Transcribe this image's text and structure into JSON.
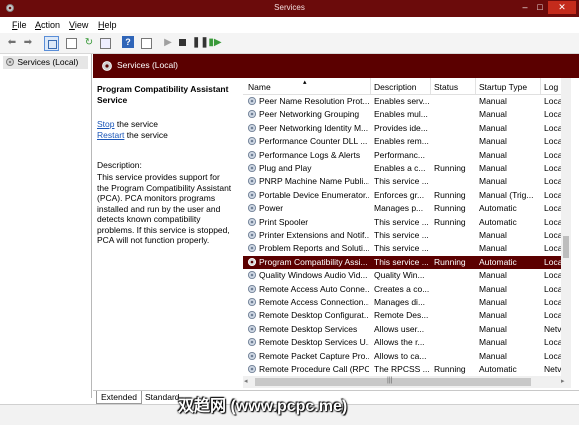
{
  "window": {
    "title": "Services"
  },
  "menus": [
    {
      "key": "F",
      "rest": "ile"
    },
    {
      "key": "A",
      "rest": "ction"
    },
    {
      "key": "V",
      "rest": "iew"
    },
    {
      "key": "H",
      "rest": "elp"
    }
  ],
  "tree": {
    "root_label": "Services (Local)"
  },
  "panel": {
    "header": "Services (Local)"
  },
  "details": {
    "service_name": "Program Compatibility Assistant Service",
    "stop_link": "Stop",
    "stop_suffix": " the service",
    "restart_link": "Restart",
    "restart_suffix": " the service",
    "desc_label": "Description:",
    "desc_text": "This service provides support for the Program Compatibility Assistant (PCA).  PCA monitors programs installed and run by the user and detects known compatibility problems. If this service is stopped, PCA will not function properly."
  },
  "columns": [
    "Name",
    "Description",
    "Status",
    "Startup Type",
    "Log"
  ],
  "rows": [
    {
      "name": "Peer Name Resolution Prot...",
      "desc": "Enables serv...",
      "status": "",
      "startup": "Manual",
      "log": "Loca"
    },
    {
      "name": "Peer Networking Grouping",
      "desc": "Enables mul...",
      "status": "",
      "startup": "Manual",
      "log": "Loca"
    },
    {
      "name": "Peer Networking Identity M...",
      "desc": "Provides ide...",
      "status": "",
      "startup": "Manual",
      "log": "Loca"
    },
    {
      "name": "Performance Counter DLL ...",
      "desc": "Enables rem...",
      "status": "",
      "startup": "Manual",
      "log": "Loca"
    },
    {
      "name": "Performance Logs & Alerts",
      "desc": "Performanc...",
      "status": "",
      "startup": "Manual",
      "log": "Loca"
    },
    {
      "name": "Plug and Play",
      "desc": "Enables a c...",
      "status": "Running",
      "startup": "Manual",
      "log": "Loca"
    },
    {
      "name": "PNRP Machine Name Publi...",
      "desc": "This service ...",
      "status": "",
      "startup": "Manual",
      "log": "Loca"
    },
    {
      "name": "Portable Device Enumerator...",
      "desc": "Enforces gr...",
      "status": "Running",
      "startup": "Manual (Trig...",
      "log": "Loca"
    },
    {
      "name": "Power",
      "desc": "Manages p...",
      "status": "Running",
      "startup": "Automatic",
      "log": "Loca"
    },
    {
      "name": "Print Spooler",
      "desc": "This service ...",
      "status": "Running",
      "startup": "Automatic",
      "log": "Loca"
    },
    {
      "name": "Printer Extensions and Notif...",
      "desc": "This service ...",
      "status": "",
      "startup": "Manual",
      "log": "Loca"
    },
    {
      "name": "Problem Reports and Soluti...",
      "desc": "This service ...",
      "status": "",
      "startup": "Manual",
      "log": "Loca"
    },
    {
      "name": "Program Compatibility Assi...",
      "desc": "This service ...",
      "status": "Running",
      "startup": "Automatic",
      "log": "Loca",
      "selected": true
    },
    {
      "name": "Quality Windows Audio Vid...",
      "desc": "Quality Win...",
      "status": "",
      "startup": "Manual",
      "log": "Loca"
    },
    {
      "name": "Remote Access Auto Conne...",
      "desc": "Creates a co...",
      "status": "",
      "startup": "Manual",
      "log": "Loca"
    },
    {
      "name": "Remote Access Connection...",
      "desc": "Manages di...",
      "status": "",
      "startup": "Manual",
      "log": "Loca"
    },
    {
      "name": "Remote Desktop Configurat...",
      "desc": "Remote Des...",
      "status": "",
      "startup": "Manual",
      "log": "Loca"
    },
    {
      "name": "Remote Desktop Services",
      "desc": "Allows user...",
      "status": "",
      "startup": "Manual",
      "log": "Netv"
    },
    {
      "name": "Remote Desktop Services U...",
      "desc": "Allows the r...",
      "status": "",
      "startup": "Manual",
      "log": "Loca"
    },
    {
      "name": "Remote Packet Capture Pro...",
      "desc": "Allows to ca...",
      "status": "",
      "startup": "Manual",
      "log": "Loca"
    },
    {
      "name": "Remote Procedure Call (RPC)",
      "desc": "The RPCSS ...",
      "status": "Running",
      "startup": "Automatic",
      "log": "Netv"
    }
  ],
  "tabs": [
    "Extended",
    "Standard"
  ],
  "watermark": "双趋网 (www.pcpc.me)",
  "colors": {
    "titlebar": "#6b0b0b",
    "panel_header": "#5b0000",
    "selected_row": "#5b0000",
    "link": "#1a56b8"
  }
}
